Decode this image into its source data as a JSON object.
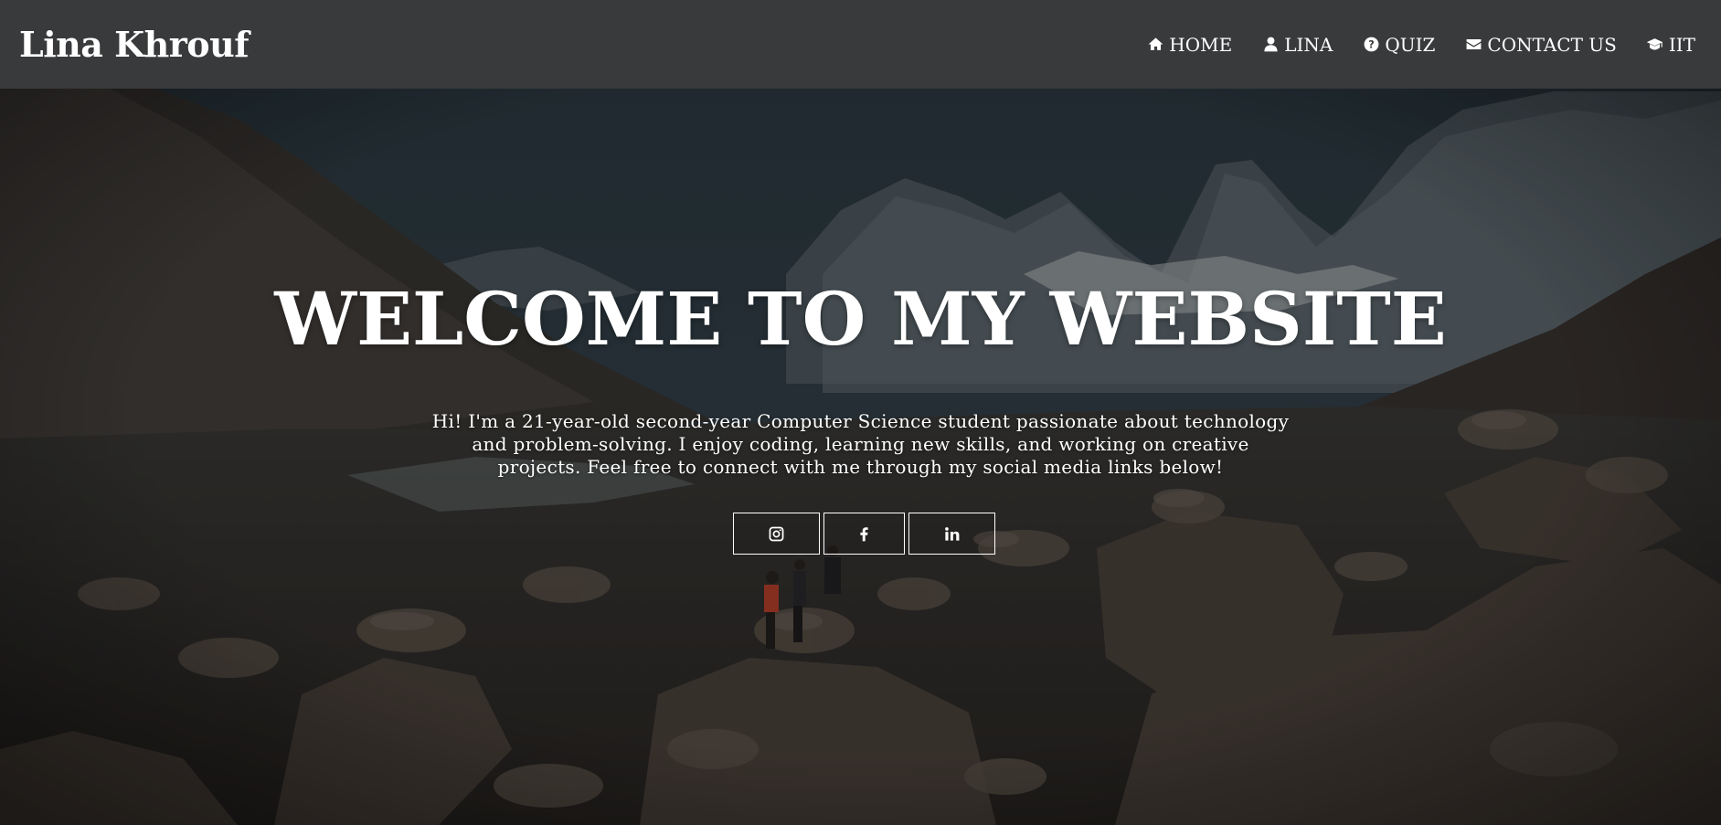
{
  "navbar": {
    "brand": "Lina Khrouf",
    "links": [
      {
        "label": "HOME",
        "icon": "home-icon"
      },
      {
        "label": "LINA",
        "icon": "user-icon"
      },
      {
        "label": "QUIZ",
        "icon": "question-circle-icon"
      },
      {
        "label": "CONTACT US",
        "icon": "envelope-icon"
      },
      {
        "label": "IIT",
        "icon": "graduation-cap-icon"
      }
    ]
  },
  "hero": {
    "title": "WELCOME TO MY WEBSITE",
    "intro_lines": [
      "Hi! I'm a 21-year-old second-year Computer Science student passionate about technology",
      "and problem-solving. I enjoy coding, learning new skills, and working on creative",
      "projects. Feel free to connect with me through my social media links below!"
    ],
    "social_links": [
      {
        "icon": "instagram-icon"
      },
      {
        "icon": "facebook-icon"
      },
      {
        "icon": "linkedin-icon"
      }
    ]
  },
  "colors": {
    "navbar_bg": "#383a3b",
    "text": "#ffffff"
  }
}
